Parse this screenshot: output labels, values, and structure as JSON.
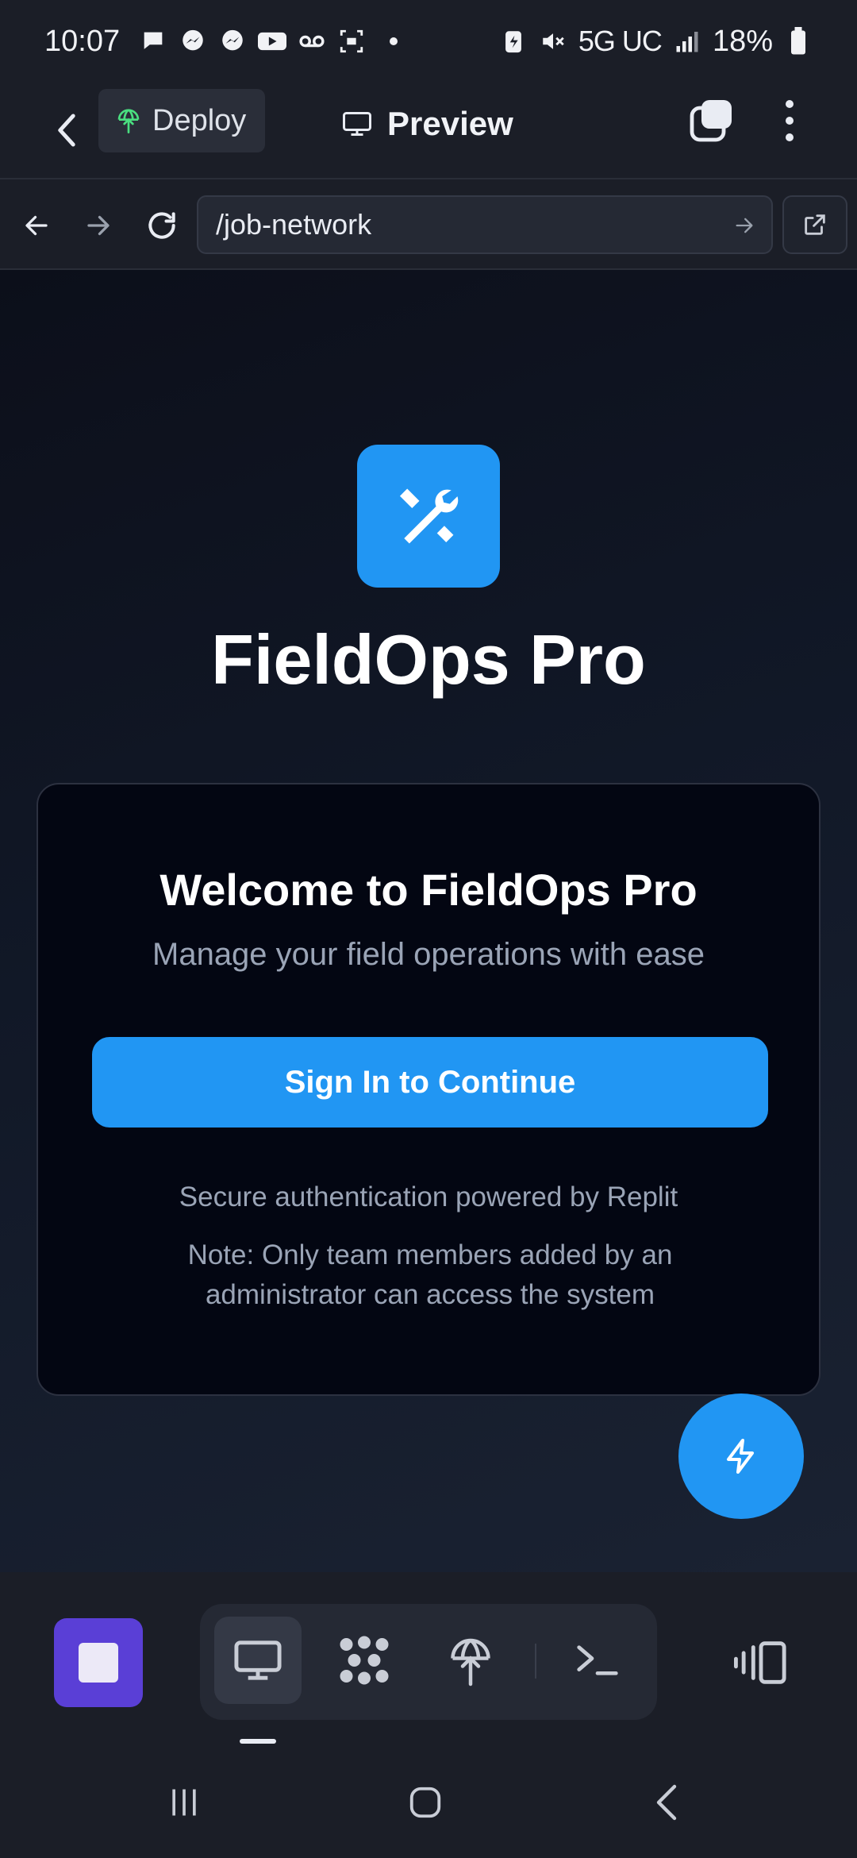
{
  "status_bar": {
    "time": "10:07",
    "network": "5G UC",
    "battery": "18%"
  },
  "app_bar": {
    "deploy_label": "Deploy",
    "preview_label": "Preview"
  },
  "browser": {
    "url": "/job-network"
  },
  "page": {
    "app_name": "FieldOps Pro",
    "welcome_title": "Welcome to FieldOps Pro",
    "welcome_subtitle": "Manage your field operations with ease",
    "signin_label": "Sign In to Continue",
    "secure_note": "Secure authentication powered by Replit",
    "access_note": "Note: Only team members added by an administrator can access the system"
  },
  "colors": {
    "accent": "#2196f3",
    "stop_button": "#5a3fd6",
    "chrome": "#1b1e27"
  },
  "icons": {
    "logo": "tools-icon",
    "fab": "lightning-icon",
    "toolbar": [
      "monitor-icon",
      "network-icon",
      "deploy-icon",
      "terminal-icon",
      "devices-icon"
    ]
  }
}
